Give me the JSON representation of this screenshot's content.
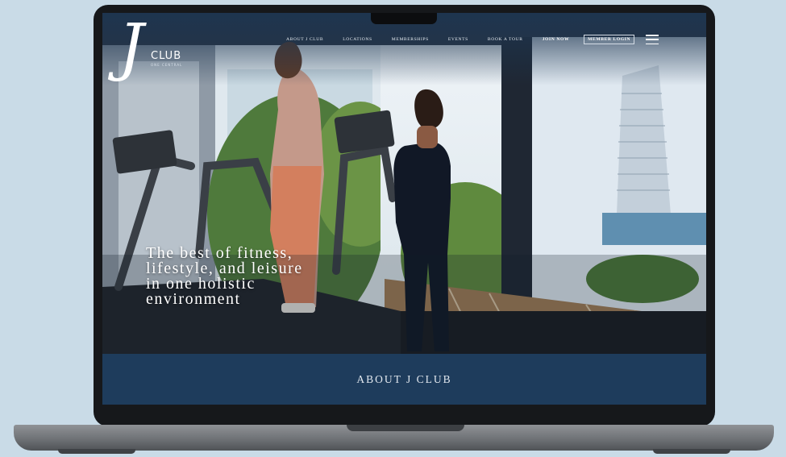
{
  "brand": {
    "logo_letter": "J",
    "logo_word": "CLUB",
    "logo_tag": "ONE CENTRAL"
  },
  "nav": {
    "items": [
      {
        "label": "ABOUT J CLUB"
      },
      {
        "label": "LOCATIONS"
      },
      {
        "label": "MEMBERSHIPS"
      },
      {
        "label": "EVENTS"
      },
      {
        "label": "BOOK A TOUR"
      }
    ],
    "join_label": "JOIN NOW",
    "login_label": "MEMBER LOGIN",
    "menu_icon": "hamburger-menu-icon"
  },
  "hero": {
    "heading_lines": [
      "The best of fitness,",
      "lifestyle, and leisure",
      "in one holistic",
      "environment"
    ]
  },
  "about": {
    "label": "ABOUT J CLUB"
  },
  "colors": {
    "background": "#c9dbe7",
    "band": "#1e3c5c",
    "header_overlay": "#1d3550"
  }
}
